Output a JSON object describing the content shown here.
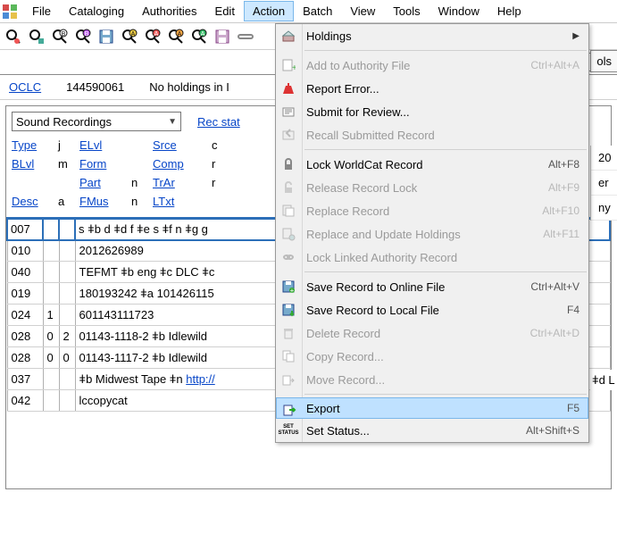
{
  "menubar": {
    "items": [
      "File",
      "Cataloging",
      "Authorities",
      "Edit",
      "Action",
      "Batch",
      "View",
      "Tools",
      "Window",
      "Help"
    ],
    "open_index": 4
  },
  "status": {
    "source": "OCLC",
    "control_number": "144590061",
    "holdings_msg": "No holdings in I"
  },
  "format": {
    "selected": "Sound Recordings",
    "recstat_label": "Rec stat"
  },
  "fixed_fields": [
    {
      "l1": "Type",
      "v1": "j",
      "l2": "ELvl",
      "v2": "",
      "l3": "Srce",
      "v3": "c"
    },
    {
      "l1": "BLvl",
      "v1": "m",
      "l2": "Form",
      "v2": "",
      "l3": "Comp",
      "v3": "r"
    },
    {
      "l1": "",
      "v1": "",
      "l2": "Part",
      "v2": "n",
      "l3": "TrAr",
      "v3": "r"
    },
    {
      "l1": "Desc",
      "v1": "a",
      "l2": "FMus",
      "v2": "n",
      "l3": "LTxt",
      "v3": ""
    }
  ],
  "marc": [
    {
      "tag": "007",
      "i1": "",
      "i2": "",
      "data": "s ǂb d ǂd f ǂe s ǂf n ǂg g",
      "selected": true
    },
    {
      "tag": "010",
      "i1": "",
      "i2": "",
      "data": "  2012626989"
    },
    {
      "tag": "040",
      "i1": "",
      "i2": "",
      "data": "TEFMT ǂb eng ǂc DLC ǂc"
    },
    {
      "tag": "019",
      "i1": "",
      "i2": "",
      "data": "180193242 ǂa 101426115"
    },
    {
      "tag": "024",
      "i1": "1",
      "i2": "",
      "data": "601143111723"
    },
    {
      "tag": "028",
      "i1": "0",
      "i2": "2",
      "data": "01143-1118-2 ǂb Idlewild"
    },
    {
      "tag": "028",
      "i1": "0",
      "i2": "0",
      "data": "01143-1117-2 ǂb Idlewild"
    },
    {
      "tag": "037",
      "i1": "",
      "i2": "",
      "data_pre": "ǂb Midwest Tape ǂn ",
      "data_link": "http://"
    },
    {
      "tag": "042",
      "i1": "",
      "i2": "",
      "data": "lccopycat"
    }
  ],
  "right_tab_label": "ols",
  "right_fragments": [
    "20",
    "er",
    "ny"
  ],
  "right_extra": "ǂd L",
  "action_menu": [
    {
      "label": "Holdings",
      "submenu": true
    },
    {
      "sep": true
    },
    {
      "label": "Add to Authority File",
      "accel": "Ctrl+Alt+A",
      "disabled": true
    },
    {
      "label": "Report Error..."
    },
    {
      "label": "Submit for Review..."
    },
    {
      "label": "Recall Submitted Record",
      "disabled": true
    },
    {
      "sep": true
    },
    {
      "label": "Lock WorldCat Record",
      "accel": "Alt+F8"
    },
    {
      "label": "Release Record Lock",
      "accel": "Alt+F9",
      "disabled": true
    },
    {
      "label": "Replace Record",
      "accel": "Alt+F10",
      "disabled": true
    },
    {
      "label": "Replace and Update Holdings",
      "accel": "Alt+F11",
      "disabled": true
    },
    {
      "label": "Lock Linked Authority Record",
      "disabled": true
    },
    {
      "sep": true
    },
    {
      "label": "Save Record to Online File",
      "accel": "Ctrl+Alt+V"
    },
    {
      "label": "Save Record to Local File",
      "accel": "F4"
    },
    {
      "label": "Delete Record",
      "accel": "Ctrl+Alt+D",
      "disabled": true
    },
    {
      "label": "Copy Record...",
      "disabled": true
    },
    {
      "label": "Move Record...",
      "disabled": true
    },
    {
      "sep": true
    },
    {
      "label": "Export",
      "accel": "F5",
      "highlight": true
    },
    {
      "label": "Set Status...",
      "accel": "Alt+Shift+S"
    }
  ]
}
